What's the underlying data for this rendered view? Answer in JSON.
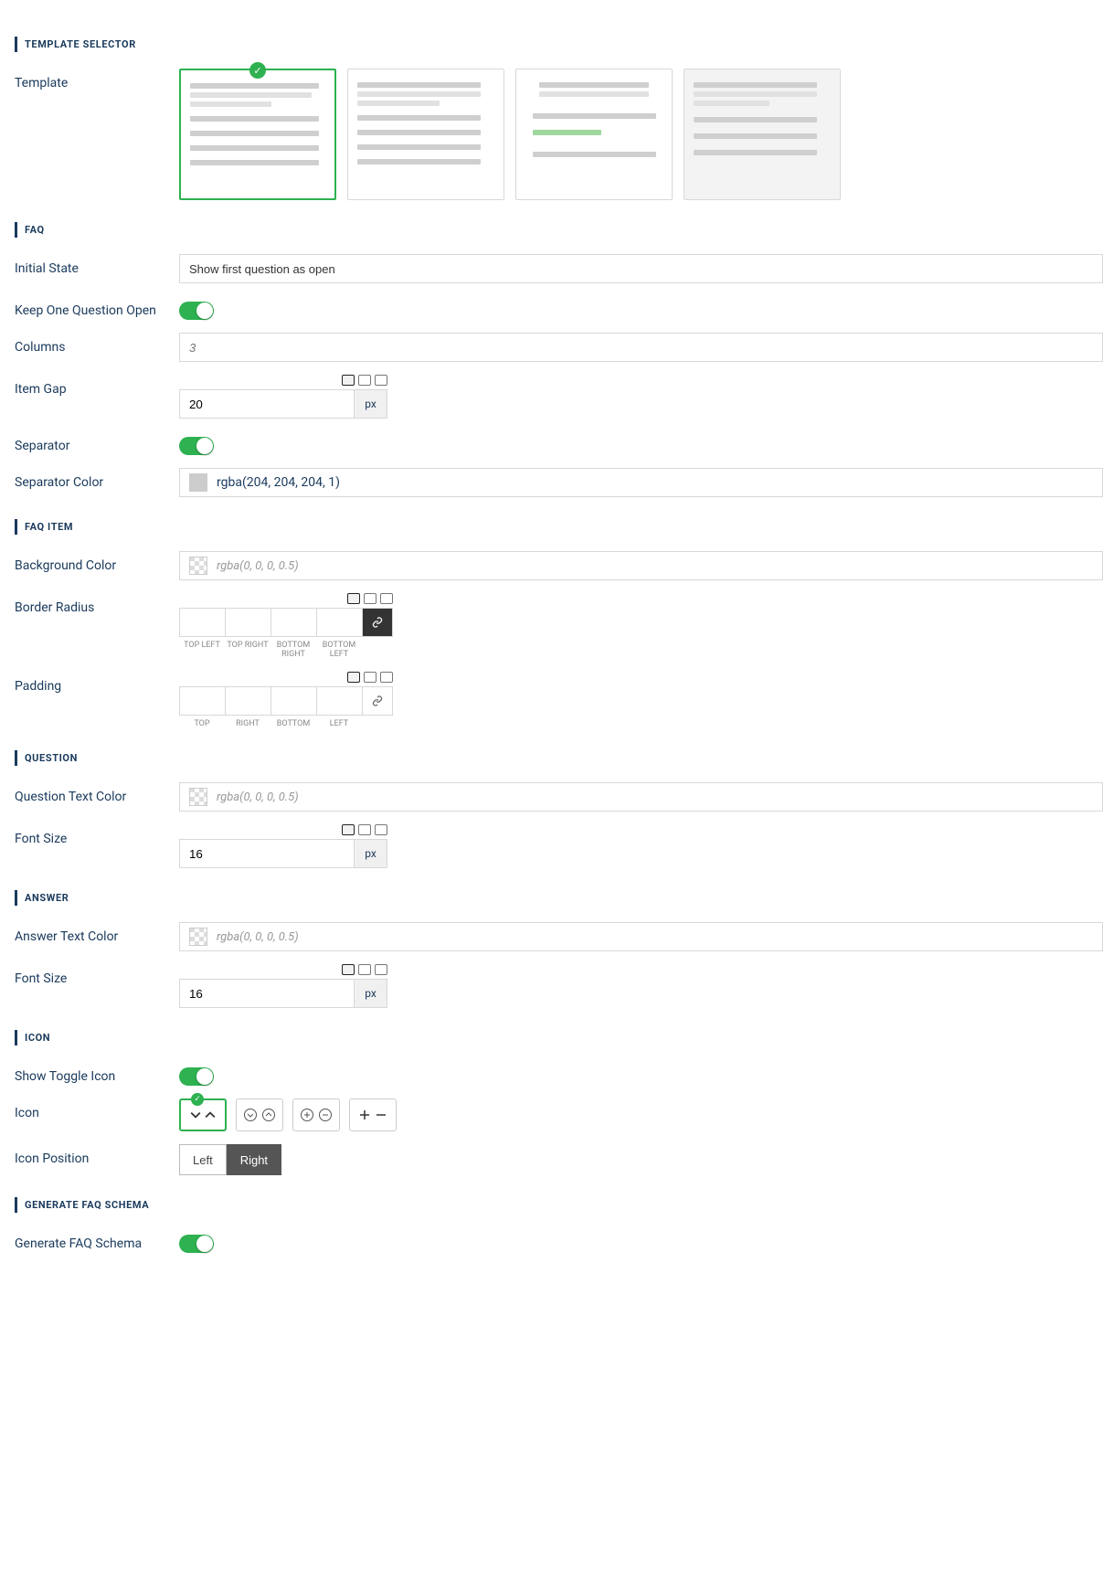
{
  "sections": {
    "template_selector": "TEMPLATE SELECTOR",
    "faq": "FAQ",
    "faq_item": "FAQ ITEM",
    "question": "QUESTION",
    "answer": "ANSWER",
    "icon": "ICON",
    "schema": "GENERATE FAQ SCHEMA"
  },
  "labels": {
    "template": "Template",
    "initial_state": "Initial State",
    "keep_one_open": "Keep One Question Open",
    "columns": "Columns",
    "item_gap": "Item Gap",
    "separator": "Separator",
    "separator_color": "Separator Color",
    "background_color": "Background Color",
    "border_radius": "Border Radius",
    "padding": "Padding",
    "question_text_color": "Question Text Color",
    "font_size": "Font Size",
    "answer_text_color": "Answer Text Color",
    "show_toggle_icon": "Show Toggle Icon",
    "icon": "Icon",
    "icon_position": "Icon Position",
    "generate_schema": "Generate FAQ Schema"
  },
  "values": {
    "initial_state": "Show first question as open",
    "columns_placeholder": "3",
    "item_gap": "20",
    "px": "px",
    "separator_color_text": "rgba(204, 204, 204, 1)",
    "separator_color_hex": "#cccccc",
    "bg_placeholder": "rgba(0, 0, 0, 0.5)",
    "question_font_size": "16",
    "answer_font_size": "16",
    "pos_left": "Left",
    "pos_right": "Right"
  },
  "radius_labels": [
    "TOP LEFT",
    "TOP RIGHT",
    "BOTTOM RIGHT",
    "BOTTOM LEFT"
  ],
  "padding_labels": [
    "TOP",
    "RIGHT",
    "BOTTOM",
    "LEFT"
  ]
}
